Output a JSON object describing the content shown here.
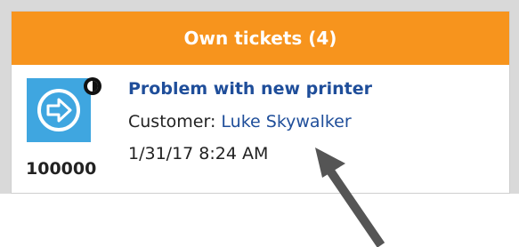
{
  "panel": {
    "title": "Own tickets (4)",
    "header_color": "#f7941d"
  },
  "ticket": {
    "id": "100000",
    "title": "Problem with new printer",
    "customer_label": "Customer:",
    "customer_name": "Luke Skywalker",
    "date": "1/31/17 8:24 AM",
    "icon": "arrow-right-circle-icon",
    "icon_color": "#3fa6e0",
    "status_icon": "clock-half-icon"
  },
  "annotation": {
    "icon": "arrow-pointer-icon",
    "color": "#555555"
  }
}
